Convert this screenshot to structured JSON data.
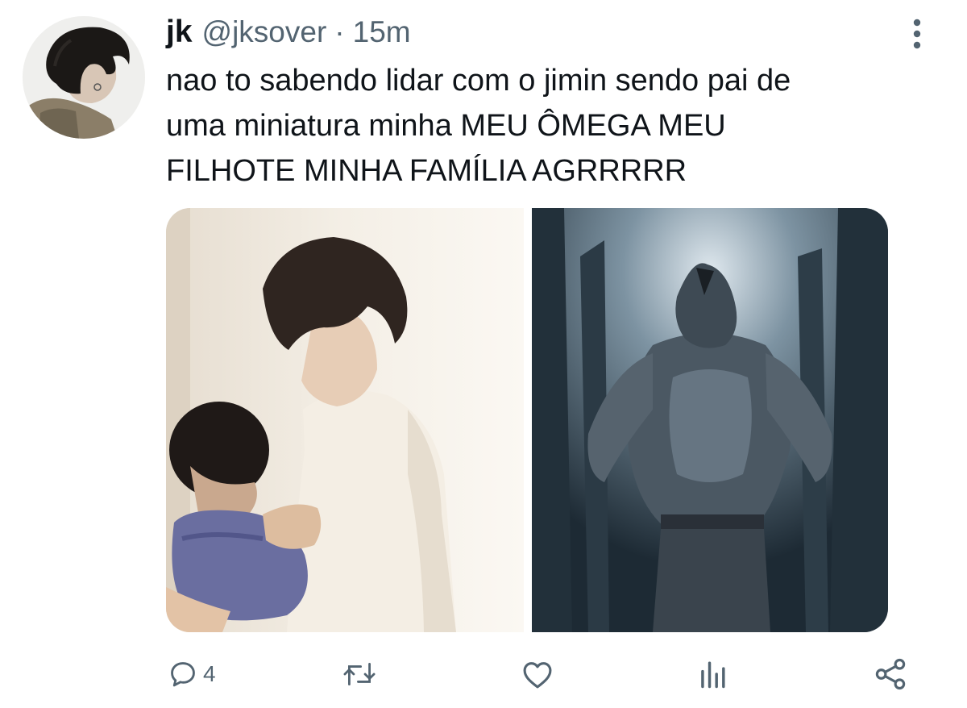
{
  "tweet": {
    "display_name": "jk",
    "handle": "@jksover",
    "separator": "·",
    "time": "15m",
    "text": "nao to sabendo lidar com o jimin sendo pai de\numa miniatura minha MEU ÔMEGA MEU\nFILHOTE MINHA FAMÍLIA AGRRRRR"
  },
  "icons": {
    "more": "more-vertical-icon",
    "reply": "reply-icon",
    "retweet": "retweet-icon",
    "like": "heart-icon",
    "views": "analytics-icon",
    "share": "share-icon"
  },
  "actions": {
    "reply_count": "4"
  },
  "colors": {
    "text": "#0f1419",
    "secondary": "#536471",
    "background": "#ffffff"
  }
}
